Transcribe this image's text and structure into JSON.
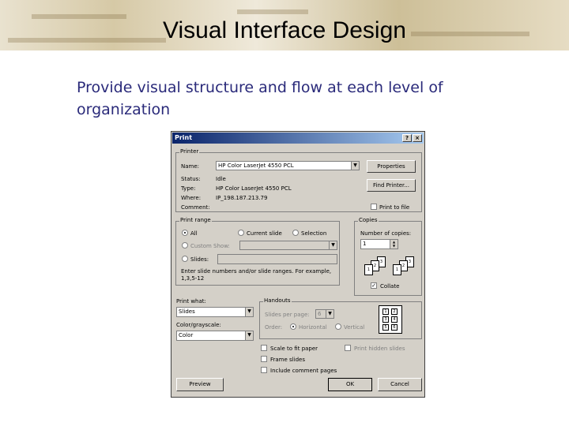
{
  "slide": {
    "title": "Visual Interface Design",
    "subtitle": "Provide visual structure and flow at each level of organization"
  },
  "dialog": {
    "title": "Print",
    "help_button": "?",
    "close_button": "×",
    "printer": {
      "group_label": "Printer",
      "name_label": "Name:",
      "name_value": "HP Color LaserJet 4550 PCL",
      "properties_button": "Properties",
      "find_printer_button": "Find Printer...",
      "status_label": "Status:",
      "status_value": "Idle",
      "type_label": "Type:",
      "type_value": "HP Color LaserJet 4550 PCL",
      "where_label": "Where:",
      "where_value": "IP_198.187.213.79",
      "comment_label": "Comment:",
      "print_to_file_label": "Print to file"
    },
    "print_range": {
      "group_label": "Print range",
      "all_label": "All",
      "current_slide_label": "Current slide",
      "selection_label": "Selection",
      "custom_show_label": "Custom Show:",
      "slides_label": "Slides:",
      "hint": "Enter slide numbers and/or slide ranges. For example, 1,3,5-12"
    },
    "copies": {
      "group_label": "Copies",
      "number_label": "Number of copies:",
      "number_value": "1",
      "collate_label": "Collate",
      "page_numbers": [
        "1",
        "2",
        "3",
        "1",
        "2",
        "3"
      ]
    },
    "print_what": {
      "label": "Print what:",
      "value": "Slides"
    },
    "color": {
      "label": "Color/grayscale:",
      "value": "Color"
    },
    "handouts": {
      "group_label": "Handouts",
      "slides_per_page_label": "Slides per page:",
      "slides_per_page_value": "6",
      "order_label": "Order:",
      "horizontal_label": "Horizontal",
      "vertical_label": "Vertical",
      "preview_numbers": [
        "1",
        "2",
        "3",
        "4",
        "5",
        "6"
      ]
    },
    "options": {
      "scale_to_fit": "Scale to fit paper",
      "frame_slides": "Frame slides",
      "include_comment_pages": "Include comment pages",
      "print_hidden_slides": "Print hidden slides"
    },
    "buttons": {
      "preview": "Preview",
      "ok": "OK",
      "cancel": "Cancel"
    }
  }
}
